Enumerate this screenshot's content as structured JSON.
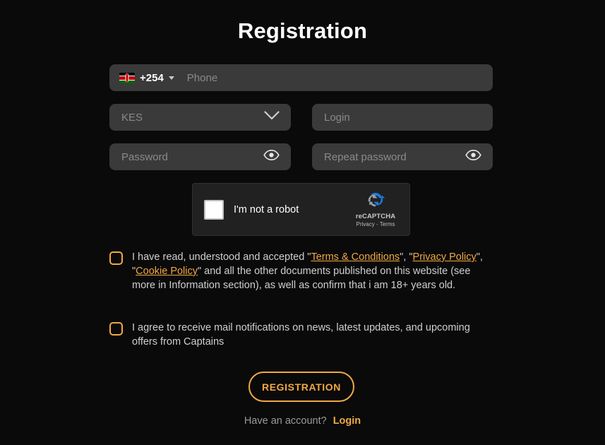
{
  "page": {
    "title": "Registration",
    "background_color": "#0a0a0a",
    "field_background_color": "#3a3a3a",
    "accent_color": "#f0a945"
  },
  "phone": {
    "country_flag": "kenya-flag",
    "dial_code": "+254",
    "placeholder": "Phone",
    "value": ""
  },
  "currency": {
    "selected": "KES",
    "icon": "chevron-down-icon"
  },
  "login_field": {
    "placeholder": "Login",
    "value": ""
  },
  "password_field": {
    "placeholder": "Password",
    "value": "",
    "toggle_icon": "eye-icon"
  },
  "repeat_password_field": {
    "placeholder": "Repeat password",
    "value": "",
    "toggle_icon": "eye-icon"
  },
  "recaptcha": {
    "label": "I'm not a robot",
    "brand": "reCAPTCHA",
    "terms": "Privacy - Terms",
    "checked": false
  },
  "terms_checkbox": {
    "checked": false,
    "text_part_1": "I  have read, understood and accepted \"",
    "link_terms": "Terms & Conditions",
    "text_part_2": "\", \"",
    "link_privacy": "Privacy Policy",
    "text_part_3": "\", \"",
    "link_cookie": "Cookie Policy",
    "text_part_4": "\" and all the other documents published on this website (see more in Information section), as well as confirm that i am 18+ years old."
  },
  "mail_checkbox": {
    "checked": false,
    "text": "I agree to receive mail notifications on news, latest updates, and upcoming offers from Captains"
  },
  "submit": {
    "label": "REGISTRATION"
  },
  "footer": {
    "question": "Have an account?",
    "login_link": "Login"
  }
}
